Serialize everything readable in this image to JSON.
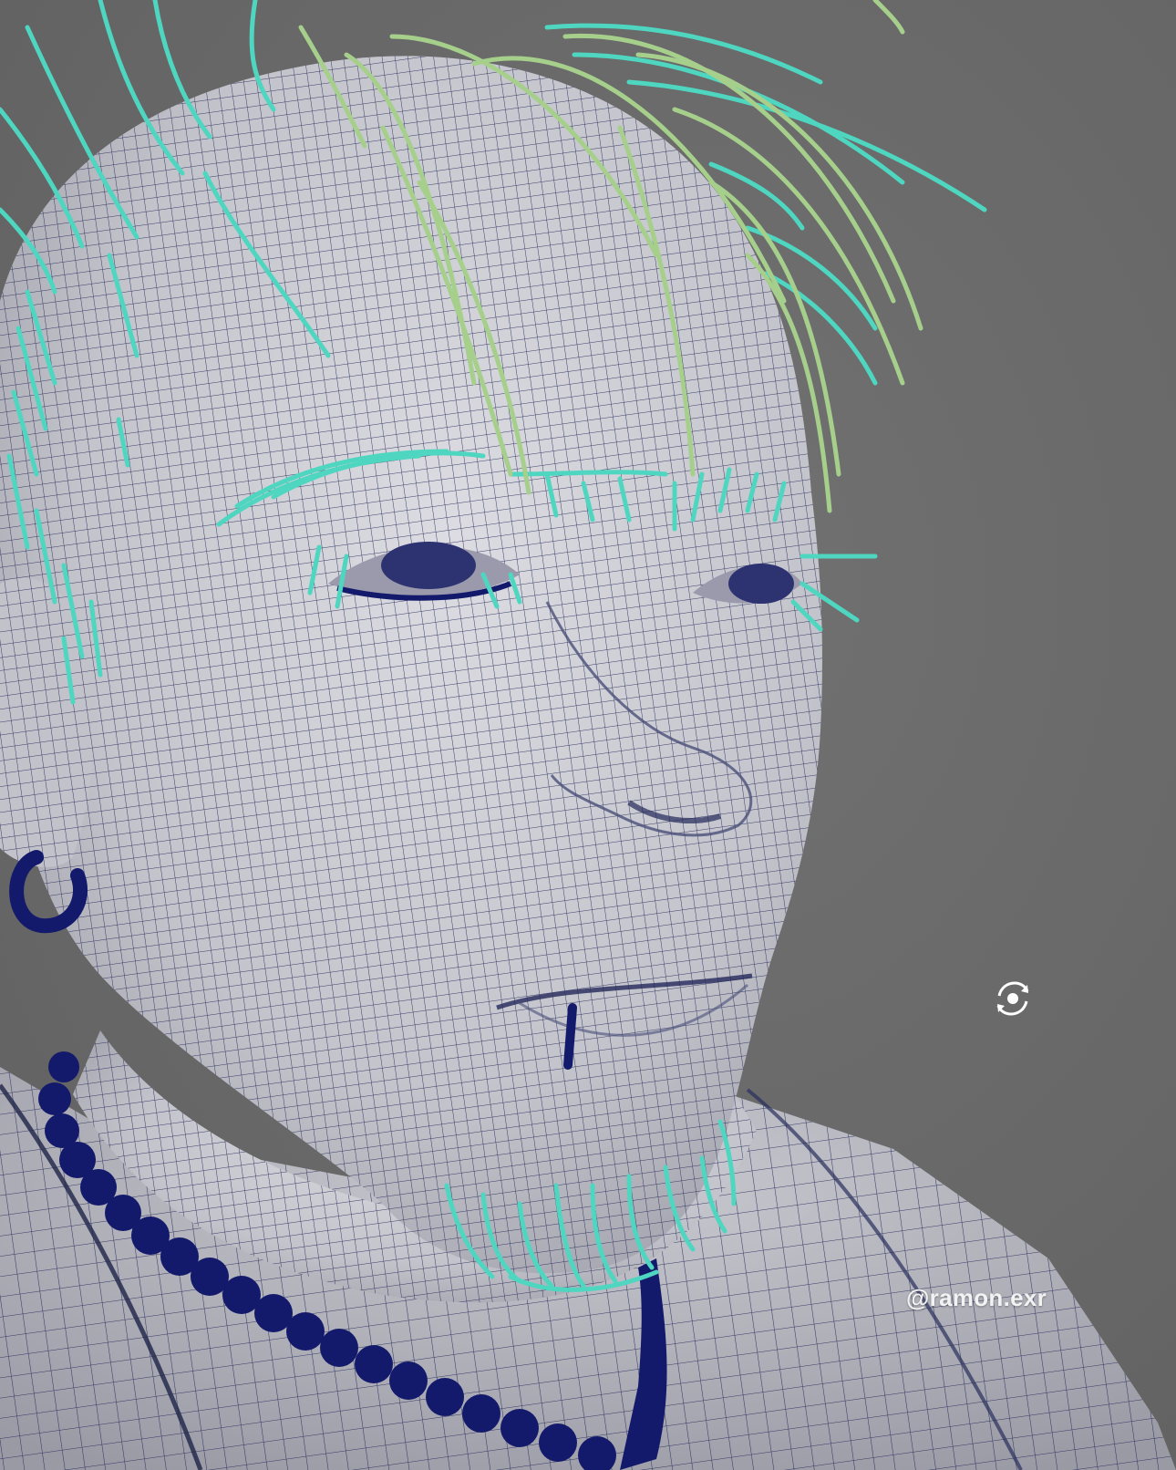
{
  "viewport": {
    "background": "#6b6b6b",
    "watermark": "@ramon.exr",
    "icons": {
      "orbit": "orbit-rotate-icon"
    }
  },
  "colors": {
    "mesh": "#c7c7cf",
    "wire": "#2a2f5c",
    "hair_cyan": "#4fd6c0",
    "hair_green": "#a6cf8c",
    "accessory": "#141a6b"
  }
}
